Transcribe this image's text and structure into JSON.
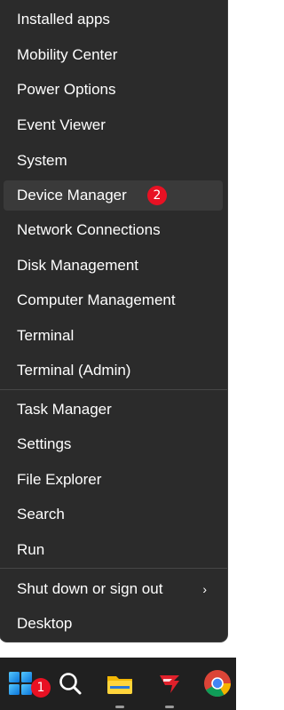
{
  "menu": {
    "items": [
      {
        "label": "Installed apps"
      },
      {
        "label": "Mobility Center"
      },
      {
        "label": "Power Options"
      },
      {
        "label": "Event Viewer"
      },
      {
        "label": "System"
      },
      {
        "label": "Device Manager"
      },
      {
        "label": "Network Connections"
      },
      {
        "label": "Disk Management"
      },
      {
        "label": "Computer Management"
      },
      {
        "label": "Terminal"
      },
      {
        "label": "Terminal (Admin)"
      },
      {
        "label": "Task Manager"
      },
      {
        "label": "Settings"
      },
      {
        "label": "File Explorer"
      },
      {
        "label": "Search"
      },
      {
        "label": "Run"
      },
      {
        "label": "Shut down or sign out"
      },
      {
        "label": "Desktop"
      }
    ],
    "hovered_item": "Device Manager",
    "submenu_chevron": "›"
  },
  "badges": {
    "device_manager": "2",
    "start": "1"
  },
  "taskbar": {
    "icons": [
      "windows-start-icon",
      "search-icon",
      "file-explorer-icon",
      "red-app-icon",
      "chrome-icon"
    ]
  },
  "colors": {
    "menu_bg": "#2b2b2b",
    "hover_bg": "#3a3a3a",
    "badge": "#e81123",
    "taskbar_bg": "#202020"
  }
}
